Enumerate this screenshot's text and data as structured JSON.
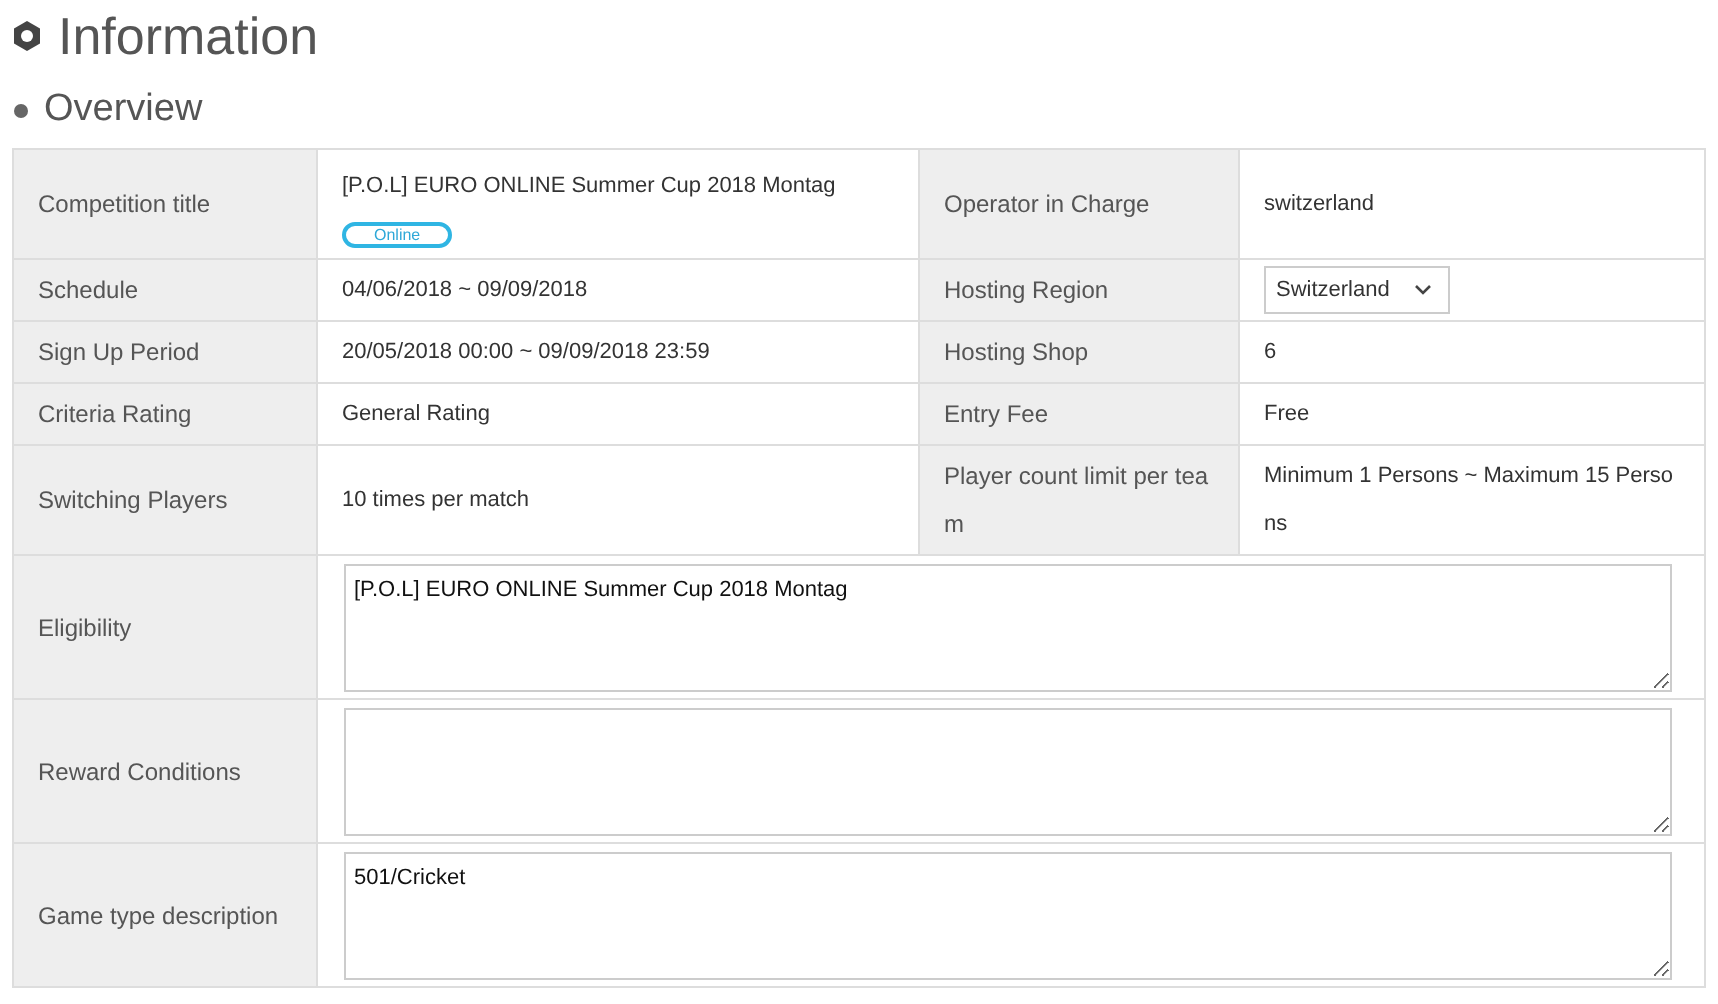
{
  "page_title": "Information",
  "section_title": "Overview",
  "pairs": [
    {
      "cells": [
        {
          "label": "Competition title",
          "kind": "badge_text",
          "value": "[P.O.L] EURO ONLINE Summer Cup 2018 Montag",
          "badge": "Online"
        },
        {
          "label": "Operator in Charge",
          "kind": "text",
          "value": "switzerland"
        }
      ]
    },
    {
      "cells": [
        {
          "label": "Schedule",
          "kind": "text",
          "value": "04/06/2018 ~ 09/09/2018"
        },
        {
          "label": "Hosting Region",
          "kind": "select",
          "value": "Switzerland"
        }
      ]
    },
    {
      "cells": [
        {
          "label": "Sign Up Period",
          "kind": "text",
          "value": "20/05/2018 00:00 ~ 09/09/2018 23:59"
        },
        {
          "label": "Hosting Shop",
          "kind": "text",
          "value": "6"
        }
      ]
    },
    {
      "cells": [
        {
          "label": "Criteria Rating",
          "kind": "text",
          "value": "General Rating"
        },
        {
          "label": "Entry Fee",
          "kind": "text",
          "value": "Free"
        }
      ]
    },
    {
      "cells": [
        {
          "label": "Switching Players",
          "kind": "text",
          "value": "10 times per match"
        },
        {
          "label": "Player count limit per team",
          "kind": "text",
          "value": "Minimum 1 Persons ~ Maximum 15 Persons"
        }
      ]
    }
  ],
  "textareas": [
    {
      "label": "Eligibility",
      "value": "[P.O.L] EURO ONLINE Summer Cup 2018 Montag"
    },
    {
      "label": "Reward Conditions"
    },
    {
      "label": "Game type description",
      "value": "501/Cricket"
    }
  ]
}
